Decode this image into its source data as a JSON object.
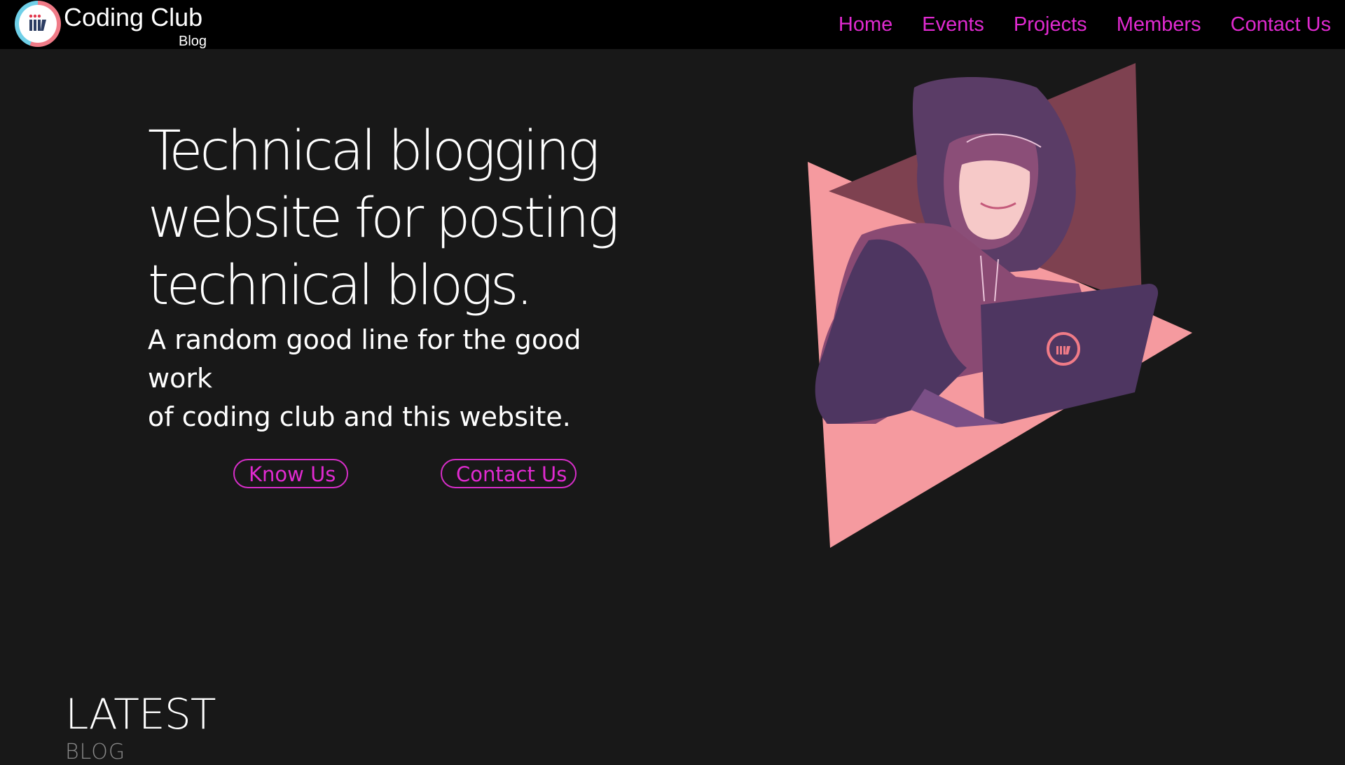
{
  "brand": {
    "name": "Coding Club",
    "sub": "Blog",
    "logo_icon": "iiitv-logo-icon"
  },
  "nav": {
    "items": [
      {
        "label": "Home"
      },
      {
        "label": "Events"
      },
      {
        "label": "Projects"
      },
      {
        "label": "Members"
      },
      {
        "label": "Contact Us"
      }
    ]
  },
  "hero": {
    "title_lines": [
      "Technical blogging",
      "website for posting",
      "technical blogs."
    ],
    "subtitle_lines": [
      "A random good line for the good work",
      "of coding club and this website."
    ],
    "buttons": {
      "know_us": "Know Us",
      "contact_us": "Contact Us"
    },
    "illustration": "hooded-coder-laptop-illustration"
  },
  "latest": {
    "title": "LATEST",
    "subtitle": "BLOG"
  },
  "colors": {
    "nav_bg": "#000000",
    "page_bg": "#181818",
    "accent": "#e02ad0",
    "triangle_pink": "#f59a9f",
    "purple": "#4e3661"
  }
}
